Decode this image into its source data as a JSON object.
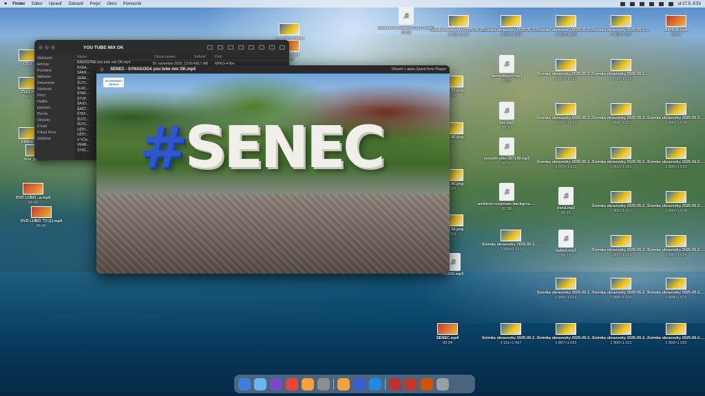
{
  "menubar": {
    "apple": "",
    "items": [
      "Finder",
      "Súbor",
      "Upraviť",
      "Zobraziť",
      "Prejsť",
      "Okno",
      "Pomocník"
    ],
    "clock": "ut 27.5.  8:53"
  },
  "finder": {
    "title": "YOU TUBE MIX OK",
    "sidebar": [
      "Obľúbené",
      "AirDrop",
      "Posledné",
      "Aplikácie",
      "Dokumenty",
      "Stiahnuté",
      "Filmy",
      "Hudba",
      "pavolam...",
      "Plocha",
      "Obrázky",
      "iCloud",
      "iCloud Drive",
      "Zdieľané"
    ],
    "columns": [
      "Názov",
      "Dátum úpravy",
      "Veľkosť",
      "Druh"
    ],
    "rows": [
      "RADOSTNÉ you tube mix OK.mp4",
      "RYBA...",
      "SAKR...",
      "SENE...",
      "ŠUTC...",
      "SLAC...",
      "STAR...",
      "STUP...",
      "ŠAJO...",
      "ŠAŠT...",
      "ŠTEF...",
      "ŠUTC...",
      "ŠUTC...",
      "UŽITI...",
      "UŽITI...",
      "V YČA...",
      "VRAB...",
      "VYSC..."
    ],
    "first_row_date": "29. novembra 2023, 13:00",
    "first_row_size": "498,7 MB",
    "first_row_kind": "MPEG-4 film"
  },
  "quicktime": {
    "title": "SENEC - SYNAGOGA you tube mix OK.mp4",
    "open_with": "Otvoriť v apke QuickTime Player",
    "sign_hash": "#",
    "sign_text": "SENEC",
    "logo_text": "SLOVENSKO ZDOLA"
  },
  "desktop_icons": [
    {
      "name": "121.1...",
      "meta": ""
    },
    {
      "name": "ZVUČKY",
      "meta": "Pol"
    },
    {
      "name": "KIRKA T",
      "meta": ""
    },
    {
      "name": "text_glow.ini",
      "meta": ""
    },
    {
      "name": "DVD LUBO...a.mp4",
      "meta": "05:00"
    },
    {
      "name": "DVD LUBO_T3 (1).mp4",
      "meta": "05:00"
    },
    {
      "name": "...il - foto zostrih",
      "meta": ""
    },
    {
      "name": "...tisty.mp4",
      "meta": "00:32"
    },
    {
      "name": "summer-is-coming-319071.mp3",
      "meta": "01:34"
    },
    {
      "name": "Snímka obrazovky 2025-05-2...8.58.25.png",
      "meta": "1 900×1 117"
    },
    {
      "name": "Snímka obrazovky 2025-05-2...10.28.12.png",
      "meta": "1 904×1 022"
    },
    {
      "name": "Snímka obrazovky 2025-05-2...9.27.22.png",
      "meta": "1 902×1 020"
    },
    {
      "name": "Snímka obrazovky 2025-05-2...9.22.03.png",
      "meta": "1 903×1 017"
    },
    {
      "name": "BAHON.mp4",
      "meta": "00:04"
    },
    {
      "name": "bernolikovo.mp3",
      "meta": "00:27"
    },
    {
      "name": "...27.30.png",
      "meta": "021"
    },
    {
      "name": "Snímka obrazovky 2025-05-2...9.27.40.png",
      "meta": "1 903×1 020"
    },
    {
      "name": "Snímka obrazovky 2025-05-2...9.27.40.png",
      "meta": "1 898×1 018"
    },
    {
      "name": "ber.mp3",
      "meta": "00:30"
    },
    {
      "name": "...58.40.png",
      "meta": "022"
    },
    {
      "name": "Snímka obrazovky 2025-05-2...9.28.16.png",
      "meta": "1 899×1 020"
    },
    {
      "name": "Snímka obrazovky 2025-05-2...9.23.55.png",
      "meta": "1 898×1 021"
    },
    {
      "name": "Snímka obrazovky 2025-05-2...9.15.50.png",
      "meta": "1 906×1 024"
    },
    {
      "name": "smooth-vibe-267149.mp3",
      "meta": "03:52"
    },
    {
      "name": "...12.40.png",
      "meta": "116"
    },
    {
      "name": "Snímka obrazovky 2025-05-2...9.28.55.png",
      "meta": "1 903×1 023"
    },
    {
      "name": "Snímka obrazovky 2025-05-2...9.24.32.png",
      "meta": "1 902×1 021"
    },
    {
      "name": "Snímka obrazovky 2025-05-2...9.19.30.png",
      "meta": "1 906×1 023"
    },
    {
      "name": "ambient-corporate-background...40562.mp3",
      "meta": "01:58"
    },
    {
      "name": "úvod.mp3",
      "meta": "00:15"
    },
    {
      "name": "...18.58.png",
      "meta": "115"
    },
    {
      "name": "Snímka obrazovky 2025-05-2...9.25.38.png",
      "meta": "1 901×1 017"
    },
    {
      "name": "Snímka obrazovky 2025-05-2...9.19.54.png",
      "meta": "1 899×1 018"
    },
    {
      "name": "Snímka obrazovky 2025-05-2...10.15.22.png",
      "meta": "1 989×1 117"
    },
    {
      "name": "bahoň.mp3",
      "meta": "00:19"
    },
    {
      "name": "...0560.mp3",
      "meta": ""
    },
    {
      "name": "Snímka obrazovky 2025-05-2...9.25.58.png",
      "meta": "1 904×1 019"
    },
    {
      "name": "Snímka obrazovky 2025-05-2...9.20.44.png",
      "meta": "1 900×1 024"
    },
    {
      "name": "Snímka obrazovky 2025-05-2...10.07.32.png",
      "meta": "1 899×1 023"
    },
    {
      "name": "Snímka obrazovky 2025-05-2...9.26.18.png",
      "meta": "1 898×1 020"
    },
    {
      "name": "Snímka obrazovky 2025-05-2...9.21.26.png",
      "meta": "1 908×1 019"
    },
    {
      "name": "SENEC.mp4",
      "meta": "00:34"
    },
    {
      "name": "Snímka obrazovky 2025-05-2...10.03.00.png",
      "meta": "1 911×1 067"
    },
    {
      "name": "Snímka obrazovky 2025-05-2...0.08.44.png",
      "meta": "1 897×1 022"
    },
    {
      "name": "Snímka obrazovky 2025-05-2...9.26.38.png",
      "meta": "1 900×1 021"
    },
    {
      "name": "Snímka obrazovky 2025-05-2...9.21.44.png",
      "meta": "1 903×1 022"
    }
  ],
  "dock": {
    "apps": [
      "finder-icon",
      "launchpad-icon",
      "imovie-icon",
      "chrome-icon",
      "photos-icon",
      "settings-icon",
      "pages-icon",
      "final-cut-icon",
      "messenger-icon",
      "video-thumb-icon",
      "video-thumb-icon",
      "video-thumb-icon",
      "trash-icon"
    ],
    "colors": [
      "#3d7fd9",
      "#6cb5f0",
      "#7a4bc7",
      "#e8463a",
      "#f2a33a",
      "#8d8d92",
      "#f4a23d",
      "#3a5ccc",
      "#1e88e5",
      "#b93131",
      "#c0392b",
      "#d35400",
      "#9aa0a6"
    ]
  }
}
